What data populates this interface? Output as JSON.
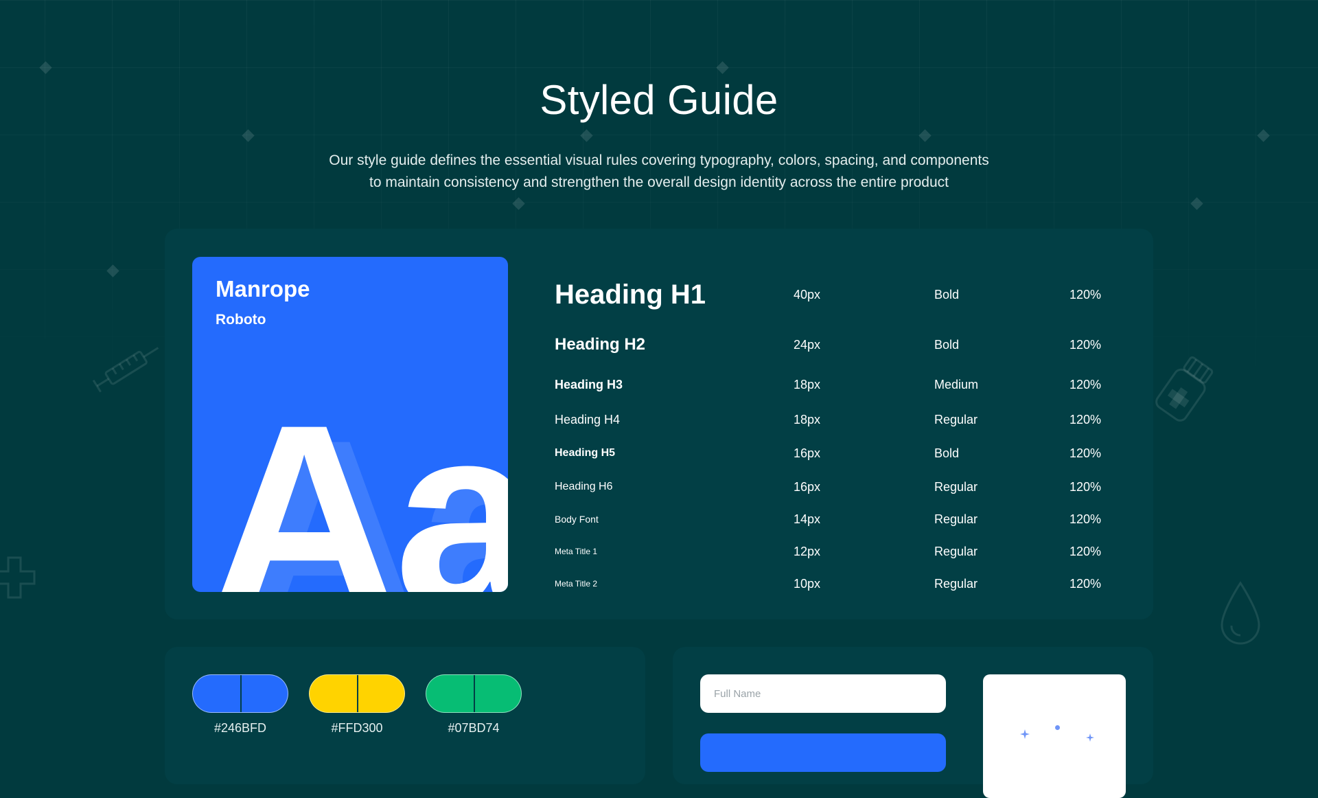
{
  "header": {
    "title": "Styled Guide",
    "subtitle_line1": "Our style guide defines the essential visual rules covering typography, colors, spacing, and components",
    "subtitle_line2": "to maintain consistency and strengthen the overall design identity across the entire product"
  },
  "typography": {
    "primary_font": "Manrope",
    "secondary_font": "Roboto",
    "sample_glyph": "Aa",
    "rows": [
      {
        "name": "Heading H1",
        "size": "40px",
        "weight": "Bold",
        "line_height": "120%"
      },
      {
        "name": "Heading H2",
        "size": "24px",
        "weight": "Bold",
        "line_height": "120%"
      },
      {
        "name": "Heading H3",
        "size": "18px",
        "weight": "Medium",
        "line_height": "120%"
      },
      {
        "name": "Heading H4",
        "size": "18px",
        "weight": "Regular",
        "line_height": "120%"
      },
      {
        "name": "Heading H5",
        "size": "16px",
        "weight": "Bold",
        "line_height": "120%"
      },
      {
        "name": "Heading H6",
        "size": "16px",
        "weight": "Regular",
        "line_height": "120%"
      },
      {
        "name": "Body Font",
        "size": "14px",
        "weight": "Regular",
        "line_height": "120%"
      },
      {
        "name": "Meta Title 1",
        "size": "12px",
        "weight": "Regular",
        "line_height": "120%"
      },
      {
        "name": "Meta Title 2",
        "size": "10px",
        "weight": "Regular",
        "line_height": "120%"
      }
    ]
  },
  "colors": {
    "swatches": [
      {
        "hex": "#246BFD",
        "color": "#246bfd"
      },
      {
        "hex": "#FFD300",
        "color": "#ffd300"
      },
      {
        "hex": "#07BD74",
        "color": "#07bd74"
      }
    ]
  },
  "components": {
    "input_placeholder": "Full Name"
  },
  "theme": {
    "background": "#013a3e",
    "card": "#023f45",
    "accent": "#246bfd"
  }
}
